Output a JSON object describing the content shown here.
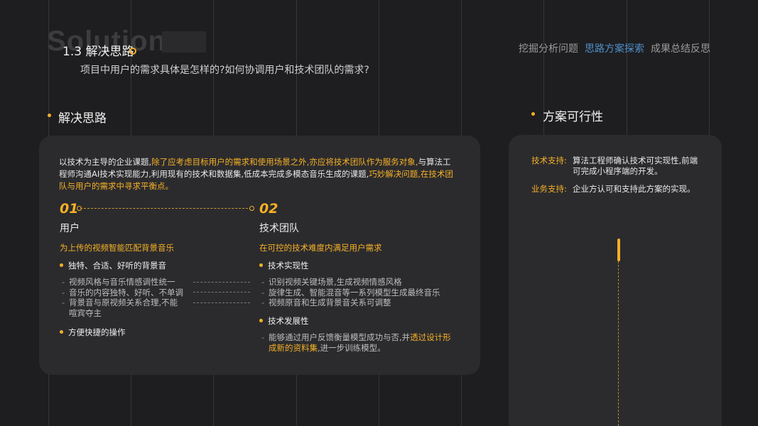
{
  "background_word": "Solutions",
  "section": {
    "title": "1.3 解决思路",
    "subtitle": "项目中用户的需求具体是怎样的?如何协调用户和技术团队的需求?"
  },
  "nav": {
    "items": [
      {
        "label": "挖掘分析问题",
        "active": false
      },
      {
        "label": "思路方案探索",
        "active": true
      },
      {
        "label": "成果总结反思",
        "active": false
      }
    ]
  },
  "left": {
    "heading": "解决思路",
    "intro": {
      "part1": "以技术为主导的企业课题,",
      "part2": "除了应考虑目标用户的需求和使用场景之外,亦应将技术团队作为服务对象,",
      "part3": "与算法工程师沟通AI技术实现能力,利用现有的技术和数据集,低成本完成多模态音乐生成的课题,",
      "part4": "巧妙解决问题,在技术团队与用户的需求中寻求平衡点。"
    },
    "col1": {
      "num": "01",
      "title": "用户",
      "subtitle": "为上传的视频智能匹配背景音乐",
      "bullet1": "独特、合适、好听的背景音",
      "items": [
        "视频风格与音乐情感调性统一",
        "音乐的内容独特、好听、不单调",
        "背景音与原视频关系合理,不能喧宾夺主"
      ],
      "bullet2": "方便快捷的操作"
    },
    "col2": {
      "num": "02",
      "title": "技术团队",
      "subtitle": "在可控的技术难度内满足用户需求",
      "bullet1": "技术实现性",
      "items": [
        "识别视频关键场景,生成视频情感风格",
        "旋律生成、智能混音等一系列模型生成最终音乐",
        "视频原音和生成背景音关系可调整"
      ],
      "bullet2": "技术发展性",
      "item4_a": "能够通过用户反馈衡量模型成功与否,并",
      "item4_hl": "透过设计形成新的资料集",
      "item4_b": ",进一步训练模型。"
    }
  },
  "right": {
    "heading": "方案可行性",
    "tech_key": "技术支持:",
    "tech_val": "算法工程师确认技术可实现性,前端可完成小程序端的开发。",
    "biz_key": "业务支持:",
    "biz_val": "企业方认可和支持此方案的实现。"
  },
  "colors": {
    "accent": "#f5b026",
    "nav_active": "#4f8fc9",
    "background": "#1e1e20",
    "panel": "#2b2b2e"
  }
}
